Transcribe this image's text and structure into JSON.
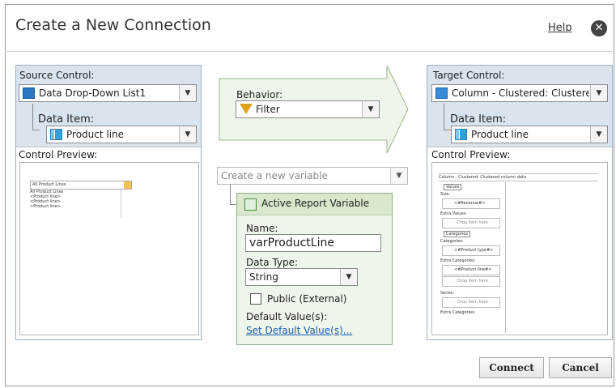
{
  "dialog": {
    "title": "Create a New Connection",
    "help_label": "Help",
    "close_glyph": "✕"
  },
  "source": {
    "label": "Source Control:",
    "control_value": "Data Drop-Down List1",
    "data_item_label": "Data Item:",
    "data_item_value": "Product line",
    "preview_label": "Control Preview:",
    "preview": {
      "dropdown_value": "All Product Lines",
      "list_items": [
        "All Product Lines",
        "<Product line>",
        "<Product line>",
        "<Product line>"
      ]
    }
  },
  "behavior": {
    "label": "Behavior:",
    "value": "Filter"
  },
  "variable": {
    "placeholder": "Create a new variable",
    "panel_title": "Active Report Variable",
    "name_label": "Name:",
    "name_value": "varProductLine",
    "type_label": "Data Type:",
    "type_value": "String",
    "public_label": "Public (External)",
    "public_checked": false,
    "default_label": "Default Value(s):",
    "default_link": "Set Default Value(s)..."
  },
  "target": {
    "label": "Target Control:",
    "control_value": "Column - Clustered: Clustered col",
    "data_item_label": "Data Item:",
    "data_item_value": "Product line",
    "preview_label": "Control Preview:",
    "preview": {
      "header": "Column - Clustered: Clustered column data",
      "values_tab": "Values",
      "size_label": "Size:",
      "revenue_item": "<#Revenue#>",
      "extra_values_label": "Extra Values:",
      "drop_here": "Drop item here",
      "categories_tab": "Categories",
      "categories_label": "Categories:",
      "product_type_item": "<#Product type#>",
      "extra_categories_label": "Extra Categories:",
      "product_line_item": "<#Product line#>",
      "series_label": "Series:",
      "extra_categories_label2": "Extra Categories:"
    }
  },
  "buttons": {
    "connect": "Connect",
    "cancel": "Cancel"
  },
  "colors": {
    "panel_header": "#d9e4ef",
    "arrow_fill": "#eef5ea",
    "variable_panel": "#eef5ea",
    "link": "#1a5fb4"
  }
}
